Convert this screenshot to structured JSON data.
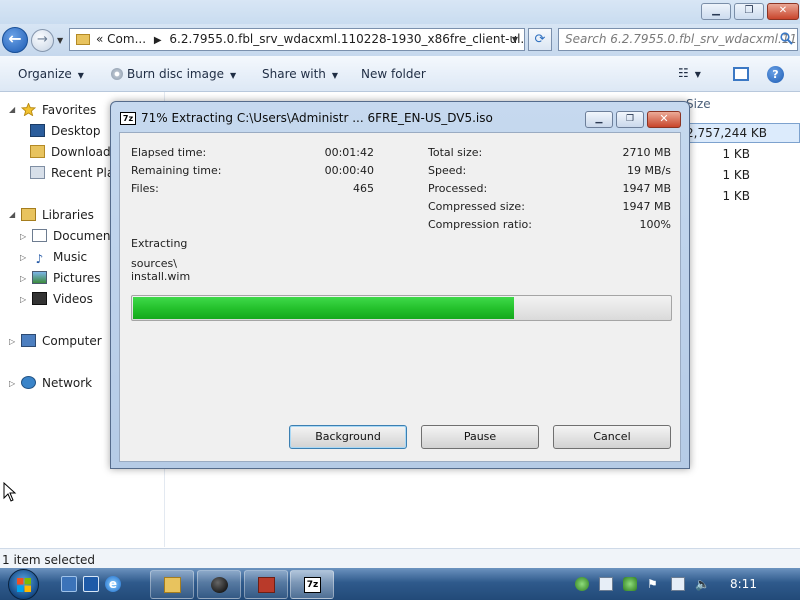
{
  "explorer": {
    "address": {
      "crumbs": [
        "«",
        "Com...",
        "6.2.7955.0.fbl_srv_wdacxml.110228-1930_x86fre_client-ul..."
      ]
    },
    "search_placeholder": "Search 6.2.7955.0.fbl_srv_wdacxml.110...",
    "toolbar": {
      "organize": "Organize",
      "burn": "Burn disc image",
      "share": "Share with",
      "new_folder": "New folder"
    },
    "nav": {
      "favorites": "Favorites",
      "desktop": "Desktop",
      "downloads": "Downloads",
      "recent": "Recent Plac",
      "libraries": "Libraries",
      "documents": "Documents",
      "music": "Music",
      "pictures": "Pictures",
      "videos": "Videos",
      "computer": "Computer",
      "network": "Network"
    },
    "file_list": {
      "size_header": "Size",
      "sizes": [
        "2,757,244 KB",
        "1 KB",
        "1 KB",
        "1 KB"
      ]
    },
    "status": "1 item selected"
  },
  "dialog": {
    "title": "71% Extracting C:\\Users\\Administr ... 6FRE_EN-US_DV5.iso",
    "icon_text": "7z",
    "left_stats": [
      {
        "label": "Elapsed time:",
        "value": "00:01:42"
      },
      {
        "label": "Remaining time:",
        "value": "00:00:40"
      },
      {
        "label": "Files:",
        "value": "465"
      }
    ],
    "right_stats": [
      {
        "label": "Total size:",
        "value": "2710 MB"
      },
      {
        "label": "Speed:",
        "value": "19 MB/s"
      },
      {
        "label": "Processed:",
        "value": "1947 MB"
      },
      {
        "label": "Compressed size:",
        "value": "1947 MB"
      },
      {
        "label": "Compression ratio:",
        "value": "100%"
      }
    ],
    "operation": "Extracting",
    "current_path": "sources\\",
    "current_file": "install.wim",
    "progress": 0.71,
    "buttons": {
      "background": "Background",
      "pause": "Pause",
      "cancel": "Cancel"
    }
  },
  "taskbar": {
    "clock": "8:11"
  },
  "colors": {
    "progress_green": "#25c22d",
    "taskbar": "#2f5a8c",
    "close_red": "#c8452b"
  }
}
